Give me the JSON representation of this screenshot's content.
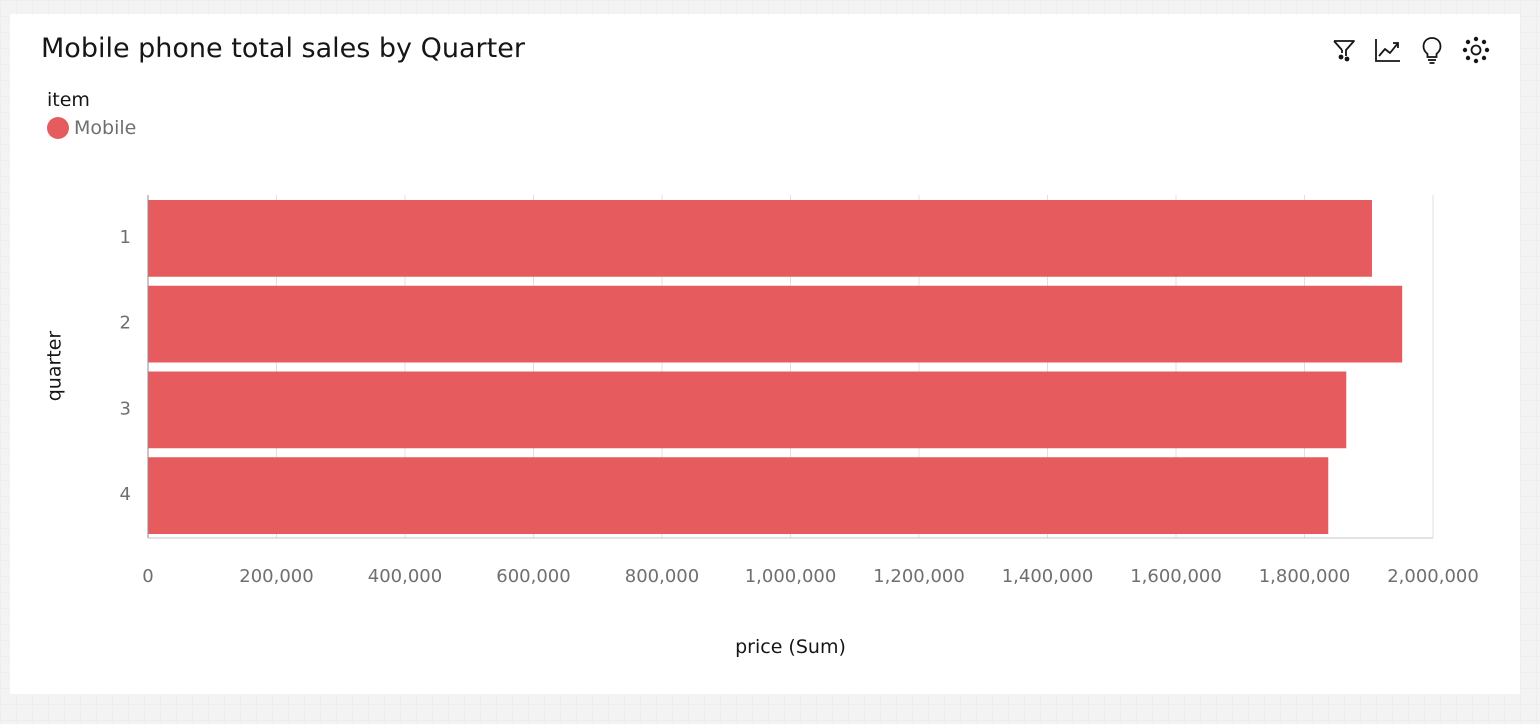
{
  "card": {
    "title": "Mobile phone total sales by Quarter"
  },
  "toolbar": [
    {
      "name": "filter-button",
      "icon": "filter-icon"
    },
    {
      "name": "trend-button",
      "icon": "trend-line-icon"
    },
    {
      "name": "insights-button",
      "icon": "lightbulb-icon"
    },
    {
      "name": "related-button",
      "icon": "network-icon"
    }
  ],
  "legend": {
    "title": "item",
    "items": [
      {
        "label": "Mobile",
        "color": "#e65b5e"
      }
    ]
  },
  "chart_data": {
    "type": "bar",
    "orientation": "horizontal",
    "categories": [
      "1",
      "2",
      "3",
      "4"
    ],
    "series": [
      {
        "name": "Mobile",
        "values": [
          1905000,
          1952000,
          1865000,
          1837000
        ]
      }
    ],
    "xlabel": "price (Sum)",
    "ylabel": "quarter",
    "xlim": [
      0,
      2000000
    ],
    "xticks": [
      0,
      200000,
      400000,
      600000,
      800000,
      1000000,
      1200000,
      1400000,
      1600000,
      1800000,
      2000000
    ],
    "xtick_labels": [
      "0",
      "200,000",
      "400,000",
      "600,000",
      "800,000",
      "1,000,000",
      "1,200,000",
      "1,400,000",
      "1,600,000",
      "1,800,000",
      "2,000,000"
    ],
    "grid": true,
    "legend_position": "top-left",
    "bar_color": "#e65b5e"
  }
}
